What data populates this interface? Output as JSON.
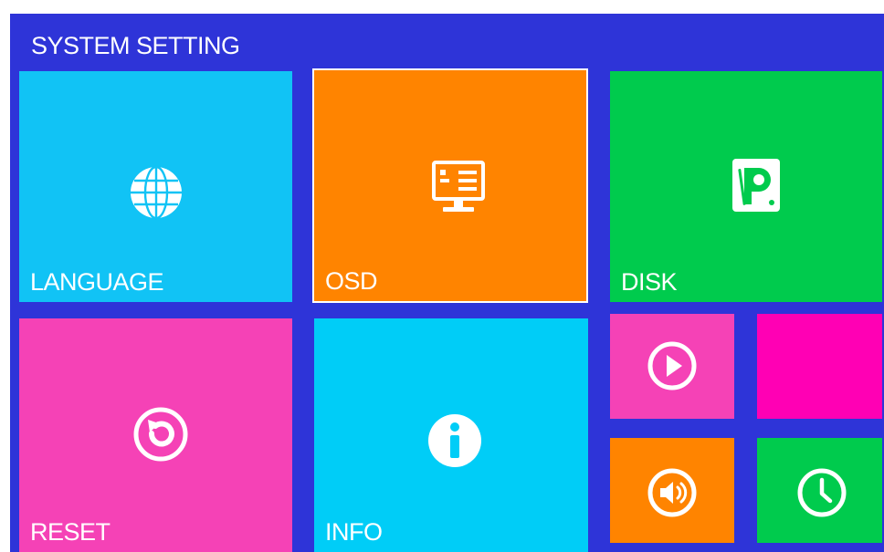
{
  "header": {
    "title": "SYSTEM SETTING"
  },
  "tiles": {
    "language": {
      "label": "LANGUAGE",
      "color": "#11c3f5",
      "icon": "globe-icon"
    },
    "osd": {
      "label": "OSD",
      "color": "#ff8400",
      "icon": "monitor-icon",
      "selected": true
    },
    "disk": {
      "label": "DISK",
      "color": "#00cb4d",
      "icon": "hard-disk-icon"
    },
    "reset": {
      "label": "RESET",
      "color": "#f542b6",
      "icon": "reset-icon"
    },
    "info": {
      "label": "INFO",
      "color": "#00cdf7",
      "icon": "info-icon"
    },
    "playback": {
      "label": "",
      "color": "#f542b6",
      "icon": "play-icon"
    },
    "blank": {
      "label": "",
      "color": "#ff00b4",
      "icon": ""
    },
    "audio": {
      "label": "",
      "color": "#ff8400",
      "icon": "speaker-icon"
    },
    "time": {
      "label": "",
      "color": "#00cb4d",
      "icon": "clock-icon"
    }
  }
}
